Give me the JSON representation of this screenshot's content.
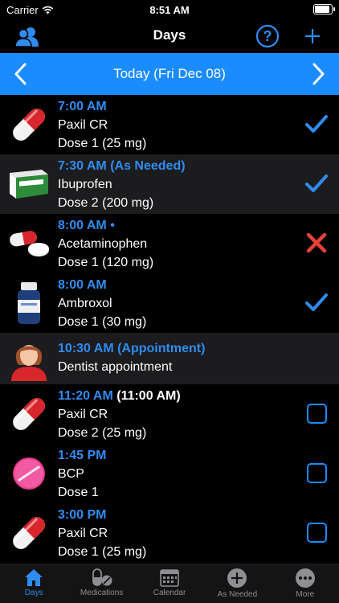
{
  "status_bar": {
    "carrier": "Carrier",
    "time": "8:51 AM",
    "battery_level": 1.0
  },
  "nav": {
    "title": "Days",
    "left_icon": "people-icon",
    "help_icon": "help-circle-icon",
    "add_icon": "plus-icon"
  },
  "date_bar": {
    "label": "Today (Fri Dec 08)",
    "prev_icon": "chevron-left-icon",
    "next_icon": "chevron-right-icon"
  },
  "rows": [
    {
      "time": "7:00 AM",
      "time_extra": "",
      "name": "Paxil CR",
      "dose": "Dose 1 (25 mg)",
      "thumb": "capsule-red",
      "status": "taken"
    },
    {
      "time": "7:30 AM (As Needed)",
      "time_extra": "",
      "name": "Ibuprofen",
      "dose": "Dose 2 (200 mg)",
      "thumb": "medicine-box",
      "status": "taken"
    },
    {
      "time": "8:00 AM •",
      "time_extra": "",
      "name": "Acetaminophen",
      "dose": "Dose 1 (120 mg)",
      "thumb": "pills-mixed",
      "status": "skipped"
    },
    {
      "time": "8:00 AM",
      "time_extra": "",
      "name": "Ambroxol",
      "dose": "Dose 1 (30 mg)",
      "thumb": "bottle",
      "status": "taken"
    },
    {
      "time": "10:30 AM (Appointment)",
      "time_extra": "",
      "name": "Dentist appointment",
      "dose": "",
      "thumb": "person",
      "status": "none"
    },
    {
      "time": "11:20 AM",
      "time_extra": "(11:00 AM)",
      "name": "Paxil CR",
      "dose": "Dose 2 (25 mg)",
      "thumb": "capsule-red",
      "status": "pending"
    },
    {
      "time": "1:45 PM",
      "time_extra": "",
      "name": "BCP",
      "dose": "Dose 1",
      "thumb": "pink-pill",
      "status": "pending"
    },
    {
      "time": "3:00 PM",
      "time_extra": "",
      "name": "Paxil CR",
      "dose": "Dose 1 (25 mg)",
      "thumb": "capsule-red",
      "status": "pending"
    }
  ],
  "tabs": [
    {
      "label": "Days",
      "icon": "house-icon",
      "active": true
    },
    {
      "label": "Medications",
      "icon": "pill-icon",
      "active": false
    },
    {
      "label": "Calendar",
      "icon": "calendar-icon",
      "active": false
    },
    {
      "label": "As Needed",
      "icon": "plus-circle-icon",
      "active": false
    },
    {
      "label": "More",
      "icon": "more-icon",
      "active": false
    }
  ],
  "colors": {
    "accent": "#2f8cf0",
    "date_bar": "#1a8cff",
    "check": "#2f8cf0",
    "cross": "#e8403a",
    "row_alt": "#1c1c1e"
  }
}
